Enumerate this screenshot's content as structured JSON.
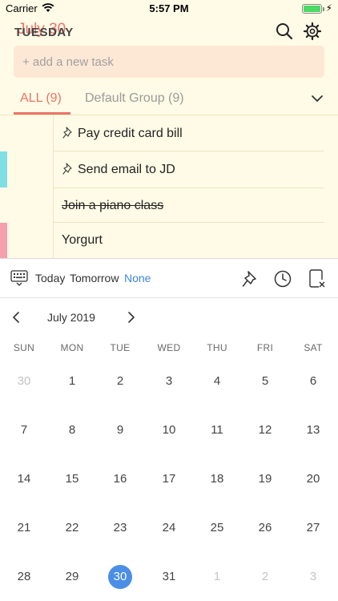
{
  "status": {
    "carrier": "Carrier",
    "time": "5:57 PM"
  },
  "header": {
    "weekday": "TUESDAY",
    "date": "July 30"
  },
  "add_task": {
    "placeholder": "+ add a new task"
  },
  "tabs": {
    "all": "ALL (9)",
    "default": "Default Group (9)"
  },
  "tasks": [
    {
      "text": "Pay credit card bill",
      "pinned": true,
      "done": false,
      "color": ""
    },
    {
      "text": "Send email to JD",
      "pinned": true,
      "done": false,
      "color": "#7fdfe4"
    },
    {
      "text": "Join a piano class",
      "pinned": false,
      "done": true,
      "color": ""
    },
    {
      "text": "Yorgurt",
      "pinned": false,
      "done": false,
      "color": "#f4a0ad"
    }
  ],
  "toolbar": {
    "today": "Today",
    "tomorrow": "Tomorrow",
    "none": "None"
  },
  "calendar": {
    "month": "July 2019",
    "weekdays": [
      "SUN",
      "MON",
      "TUE",
      "WED",
      "THU",
      "FRI",
      "SAT"
    ],
    "weeks": [
      [
        "30",
        "1",
        "2",
        "3",
        "4",
        "5",
        "6"
      ],
      [
        "7",
        "8",
        "9",
        "10",
        "11",
        "12",
        "13"
      ],
      [
        "14",
        "15",
        "16",
        "17",
        "18",
        "19",
        "20"
      ],
      [
        "21",
        "22",
        "23",
        "24",
        "25",
        "26",
        "27"
      ],
      [
        "28",
        "29",
        "30",
        "31",
        "1",
        "2",
        "3"
      ]
    ],
    "selected": "30"
  },
  "colors": {
    "accent": "#e8746a",
    "select": "#4a8ee6",
    "link": "#3f86e0"
  }
}
